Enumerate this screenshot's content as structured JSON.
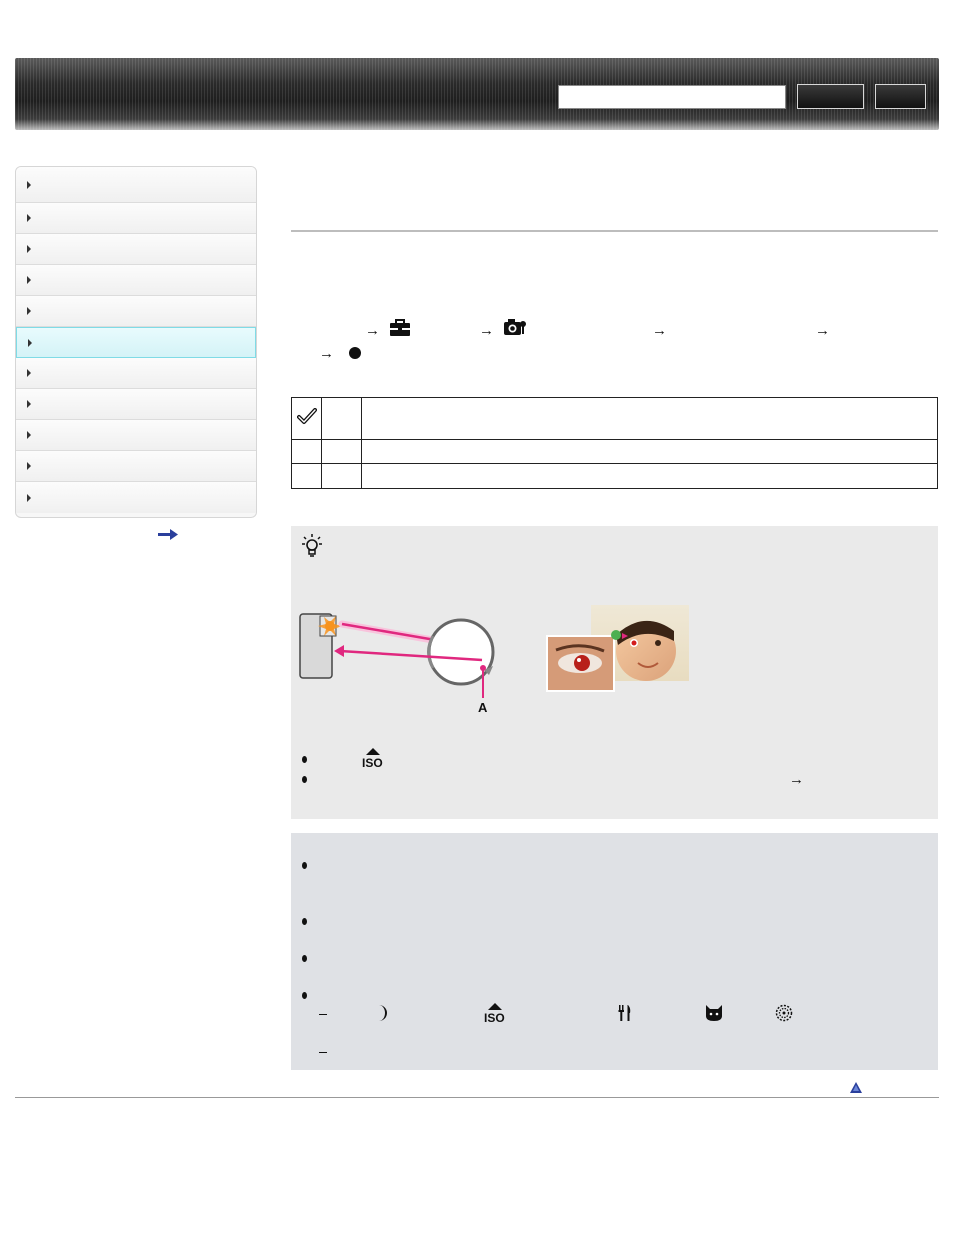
{
  "header": {
    "search_placeholder": "",
    "search_button_label": "",
    "extra_button_label": ""
  },
  "sidebar": {
    "items": [
      {
        "label": "",
        "active": false
      },
      {
        "label": "",
        "active": false
      },
      {
        "label": "",
        "active": false
      },
      {
        "label": "",
        "active": false
      },
      {
        "label": "",
        "active": false
      },
      {
        "label": "",
        "active": true
      },
      {
        "label": "",
        "active": false
      },
      {
        "label": "",
        "active": false
      },
      {
        "label": "",
        "active": false
      },
      {
        "label": "",
        "active": false
      },
      {
        "label": "",
        "active": false
      }
    ]
  },
  "main": {
    "title": "",
    "intro": "",
    "steps": {
      "arrow": "→"
    },
    "table": {
      "rows": [
        {
          "icon": "checkmark-icon",
          "value": "",
          "description": ""
        },
        {
          "icon": "",
          "value": "",
          "description": ""
        },
        {
          "icon": "",
          "value": "",
          "description": ""
        }
      ]
    },
    "hint": {
      "figure_label": "A",
      "arrow": "→"
    }
  },
  "colors": {
    "magenta": "#e0287f",
    "active_nav": "#d4f3f7",
    "hint_bg": "#eaeaea",
    "notes_bg": "#dfe1e5"
  }
}
